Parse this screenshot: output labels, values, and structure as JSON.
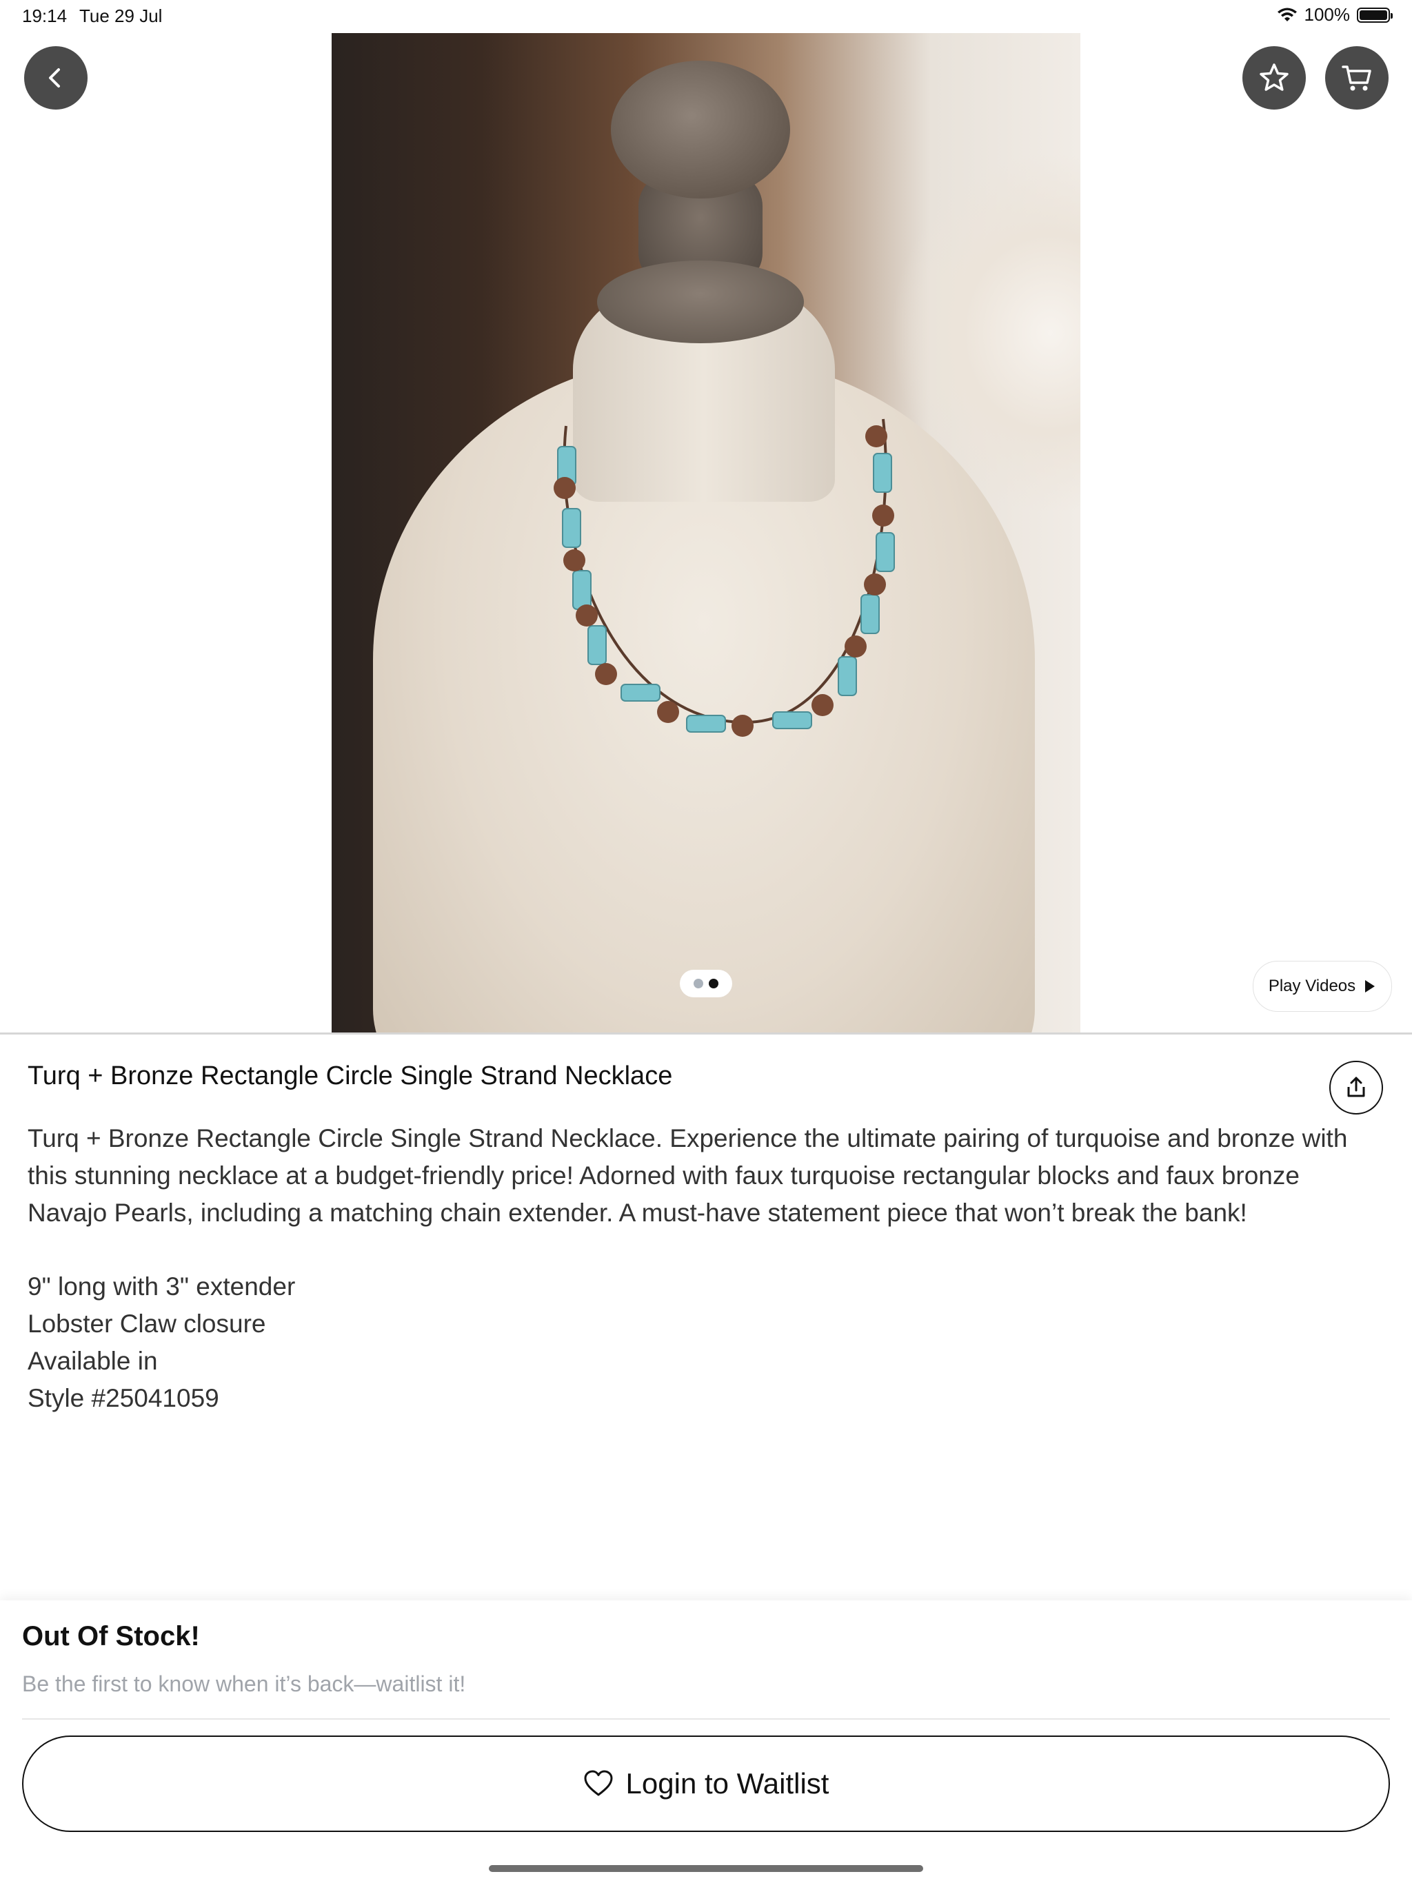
{
  "status_bar": {
    "time": "19:14",
    "date": "Tue 29 Jul",
    "battery": "100%",
    "battery_level": 1.0
  },
  "gallery": {
    "image_alt": "necklace-on-bust-photo",
    "page_count": 2,
    "active_page": 2,
    "play_videos_label": "Play Videos"
  },
  "product": {
    "title": "Turq + Bronze Rectangle Circle Single Strand Necklace",
    "description": "Turq + Bronze Rectangle Circle Single Strand Necklace. Experience the ultimate pairing of turquoise and bronze with this stunning necklace at a budget-friendly price! Adorned with faux turquoise rectangular blocks and faux bronze Navajo Pearls, including a matching chain extender. A must-have statement piece that won’t break the bank!",
    "specs": [
      "9\" long with 3\" extender",
      "Lobster Claw closure",
      "Available in",
      "Style #25041059"
    ]
  },
  "stock": {
    "title": "Out Of Stock!",
    "subtitle": "Be the first to know when it’s back—waitlist it!",
    "button_label": "Login to Waitlist"
  },
  "icons": {
    "back": "chevron-left-icon",
    "favorite": "star-icon",
    "cart": "cart-icon",
    "share": "share-icon",
    "play": "play-icon",
    "heart": "heart-icon",
    "wifi": "wifi-icon",
    "battery": "battery-icon"
  },
  "colors": {
    "button_bg": "#4a4a4a",
    "muted_text": "#a0a4aa",
    "accent_turquoise": "#7cc7cf",
    "accent_bronze": "#7a4a34"
  }
}
